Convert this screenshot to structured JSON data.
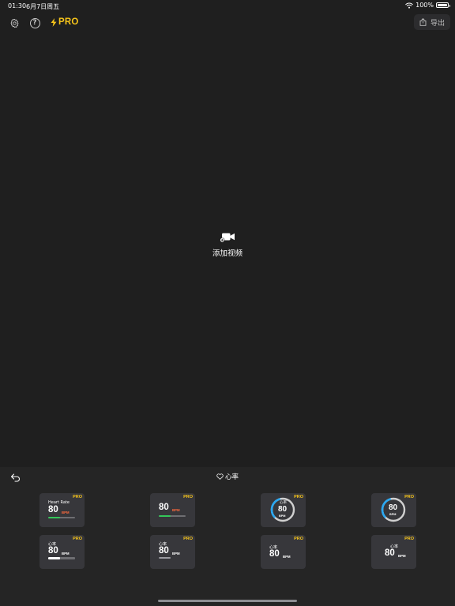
{
  "status_bar": {
    "time": "01:30",
    "date": "6月7日周五",
    "battery_text": "100%"
  },
  "toolbar": {
    "settings_icon": "gear-icon",
    "help_icon": "question-icon",
    "help_glyph": "?",
    "pro_label": "PRO",
    "export_label": "导出"
  },
  "canvas": {
    "add_video_label": "添加视频",
    "icon": "video-camera-add-icon"
  },
  "panel": {
    "title": "心率",
    "undo_icon": "undo-icon",
    "heart_icon": "heart-icon",
    "templates": [
      {
        "pro": "PRO",
        "label": "Heart Rate",
        "value": "80",
        "unit": "BPM",
        "unit_color": "#ff6a3d",
        "progress": 0.45,
        "bar_color": "#34c759",
        "style": "bar"
      },
      {
        "pro": "PRO",
        "label": "",
        "value": "80",
        "unit": "BPM",
        "unit_color": "#ff6a3d",
        "progress": 0.45,
        "bar_color": "#34c759",
        "style": "bar"
      },
      {
        "pro": "PRO",
        "label": "心率",
        "value": "80",
        "unit": "BPM",
        "unit_color": "#ffffff",
        "progress": 0.45,
        "arc_color": "#2aa8f2",
        "style": "gauge"
      },
      {
        "pro": "PRO",
        "label": "",
        "value": "80",
        "unit": "BPM",
        "unit_color": "#ffffff",
        "progress": 0.45,
        "arc_color": "#2aa8f2",
        "style": "gauge"
      },
      {
        "pro": "PRO",
        "label": "心率",
        "value": "80",
        "unit": "BPM",
        "unit_color": "#ffffff",
        "progress": 0.45,
        "bar_color": "#ffffff",
        "style": "bar"
      },
      {
        "pro": "PRO",
        "label": "心率",
        "value": "80",
        "unit": "BPM",
        "unit_color": "#ffffff",
        "progress": 0.45,
        "bar_color": "#9a9aa0",
        "style": "bar"
      },
      {
        "pro": "PRO",
        "label": "心率",
        "value": "80",
        "unit": "BPM",
        "unit_color": "#ffffff",
        "style": "plain"
      },
      {
        "pro": "PRO",
        "label": "心率",
        "value": "80",
        "unit": "BPM",
        "unit_color": "#ffffff",
        "style": "plain"
      }
    ]
  },
  "colors": {
    "accent": "#f7c51a",
    "background": "#1f1f1f",
    "panel": "#252525",
    "card": "#37373b"
  }
}
